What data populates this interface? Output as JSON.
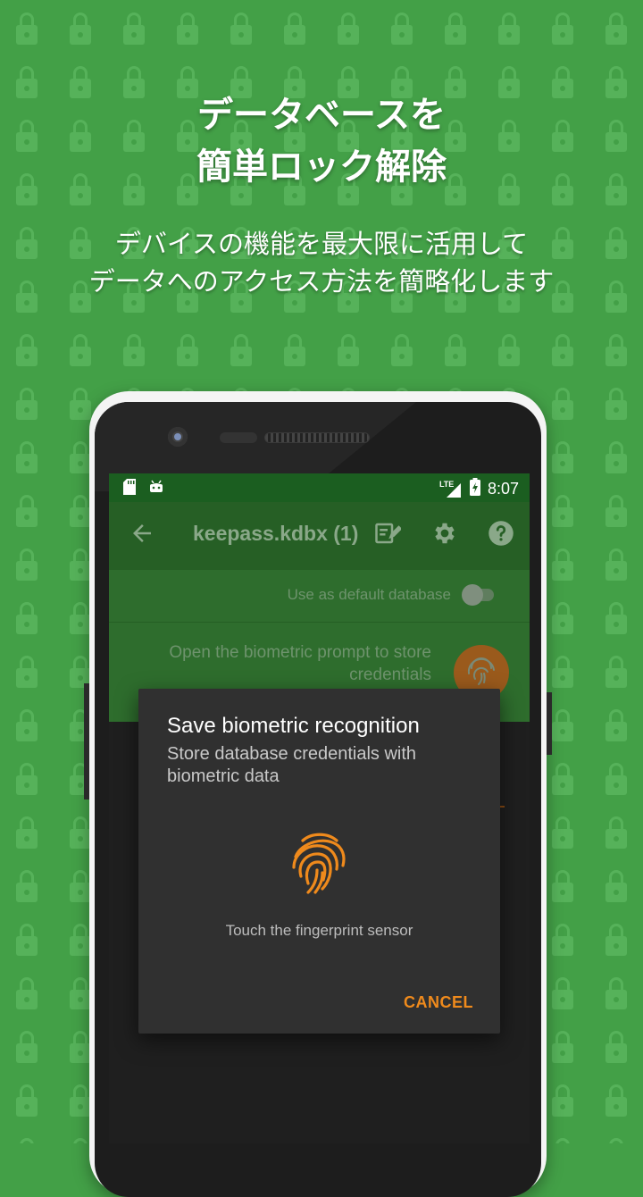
{
  "promo": {
    "headline_line1": "データベースを",
    "headline_line2": "簡単ロック解除",
    "sub_line1": "デバイスの機能を最大限に活用して",
    "sub_line2": "データへのアクセス方法を簡略化します"
  },
  "statusbar": {
    "network": "LTE",
    "time": "8:07"
  },
  "toolbar": {
    "title": "keepass.kdbx (1)"
  },
  "settings": {
    "default_db_label": "Use as default database",
    "default_db_enabled": false,
    "biometric_label": "Open the biometric prompt to store credentials"
  },
  "dialog": {
    "title": "Save biometric recognition",
    "subtitle": "Store database credentials with biometric data",
    "hint": "Touch the fingerprint sensor",
    "cancel_label": "CANCEL"
  },
  "colors": {
    "background_green": "#43a047",
    "accent_orange": "#ef8a1c",
    "dialog_bg": "#303030",
    "statusbar": "#1b5e20"
  },
  "icons": [
    "lock-pattern",
    "sd-card-icon",
    "android-icon",
    "lte-signal-icon",
    "battery-charging-icon",
    "back-arrow-icon",
    "edit-icon",
    "settings-gear-icon",
    "help-icon",
    "fingerprint-icon"
  ]
}
